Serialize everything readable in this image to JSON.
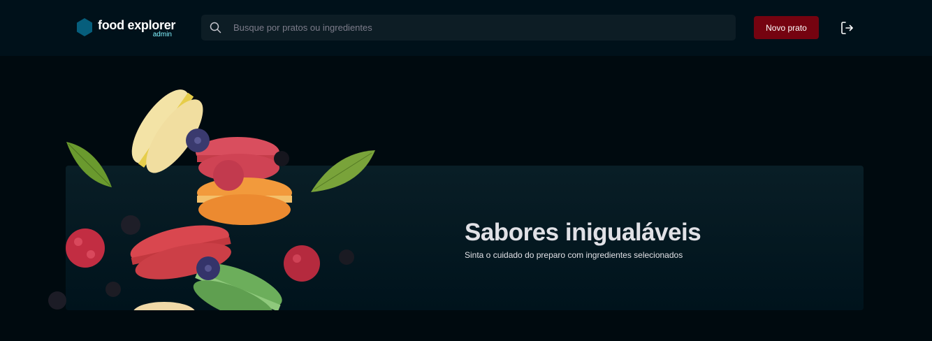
{
  "header": {
    "logo": {
      "name": "food explorer",
      "subtitle": "admin",
      "icon": "hexagon-logo-icon",
      "color": "#065e7c"
    },
    "search": {
      "placeholder": "Busque por pratos ou ingredientes",
      "value": "",
      "icon": "search-icon"
    },
    "new_dish_button": {
      "label": "Novo prato",
      "color": "#750310"
    },
    "logout": {
      "icon": "sign-out-icon"
    }
  },
  "banner": {
    "title": "Sabores inigualáveis",
    "subtitle": "Sinta o cuidado do preparo com ingredientes selecionados",
    "image": "macarons-icon"
  }
}
